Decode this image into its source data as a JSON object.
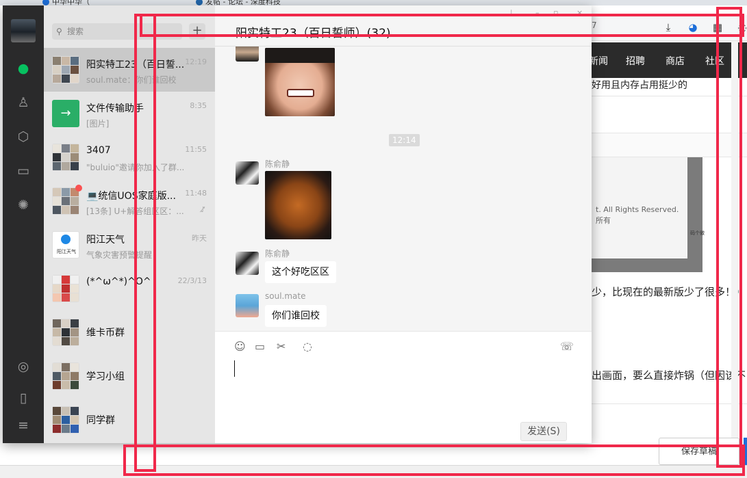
{
  "browser": {
    "tabs": [
      "中华中华（",
      "发帖 - 论坛 - 深度科技"
    ],
    "url_tail": "7",
    "nav": [
      "新闻",
      "招聘",
      "商店",
      "社区"
    ],
    "article_lines": [
      "好用且内存占用挺少的",
      "少，比现在的最新版少了很多！）",
      "出画面，要么直接炸锅（但因该不"
    ],
    "image_caption_1": "t. All Rights Reserved.",
    "image_caption_2": "所有",
    "image_caption_3": "码个微",
    "save_draft": "保存草稿"
  },
  "app": {
    "search_placeholder": "搜索",
    "add_button": "+",
    "conversations": [
      {
        "name": "阳实特工23（百日誓...",
        "preview": "soul.mate：你们谁回校",
        "time": "12:19",
        "selected": true
      },
      {
        "name": "文件传输助手",
        "preview": "[图片]",
        "time": "8:35"
      },
      {
        "name": "3407",
        "preview": "\"buluio\"邀请你加入了群...",
        "time": "11:55"
      },
      {
        "name": "💻统信UOS家庭版...",
        "preview": "[13条] U+解答组区区：...",
        "time": "11:48",
        "unread": true,
        "muted": true
      },
      {
        "name": "阳江天气",
        "preview": "气象灾害预警提醒",
        "time": "昨天"
      },
      {
        "name": "(*^ω^*)^O^",
        "preview": "",
        "time": "22/3/13"
      },
      {
        "name": "维卡币群",
        "preview": "",
        "time": ""
      },
      {
        "name": "学习小组",
        "preview": "",
        "time": ""
      },
      {
        "name": "同学群",
        "preview": "",
        "time": ""
      }
    ],
    "file_helper_label": "→",
    "weather_logo_text": "阳江天气",
    "chat": {
      "title": "阳实特工23（百日誓师）(32)",
      "time_divider": "12:14",
      "messages": [
        {
          "sender": "陈俞静",
          "type": "image"
        },
        {
          "sender": "陈俞静",
          "type": "text",
          "text": "这个好吃区区"
        },
        {
          "sender": "soul.mate",
          "type": "text",
          "text": "你们谁回校"
        }
      ],
      "send_button": "发送(S)"
    }
  },
  "colors": {
    "accent_green": "#07c160",
    "annotation_red": "#f0284a",
    "rail_bg": "#2a2a2b"
  }
}
